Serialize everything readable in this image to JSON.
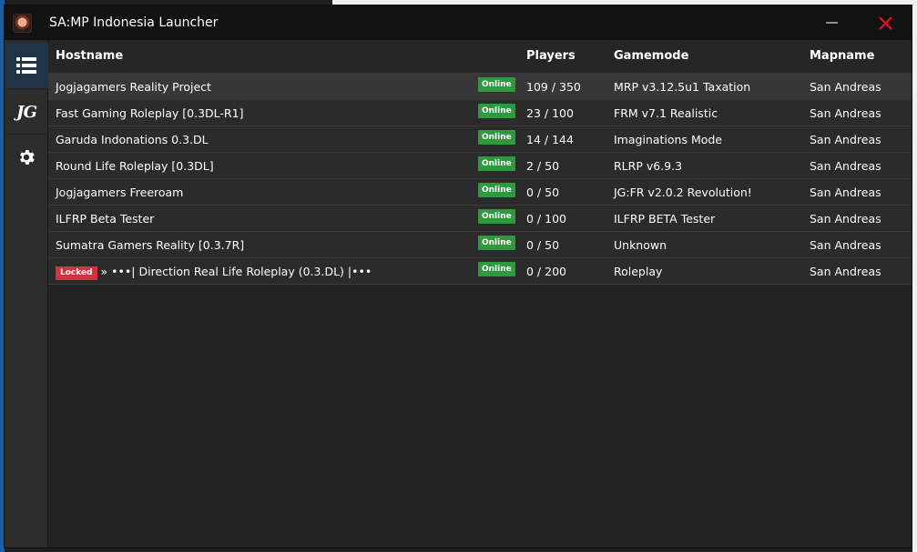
{
  "window": {
    "title": "SA:MP Indonesia Launcher"
  },
  "sidebar": {
    "items": [
      {
        "name": "server-list",
        "icon": "list-icon",
        "active": true
      },
      {
        "name": "jg",
        "label": "JG",
        "icon": "jg-logo-icon",
        "active": false
      },
      {
        "name": "settings",
        "icon": "gear-icon",
        "active": false
      }
    ]
  },
  "table": {
    "columns": {
      "hostname": "Hostname",
      "players": "Players",
      "gamemode": "Gamemode",
      "mapname": "Mapname"
    },
    "rows": [
      {
        "hostname": "Jogjagamers Reality Project",
        "status": "Online",
        "players": "109 / 350",
        "gamemode": "MRP v3.12.5u1 Taxation",
        "mapname": "San Andreas",
        "locked": false
      },
      {
        "hostname": "Fast Gaming Roleplay [0.3DL-R1]",
        "status": "Online",
        "players": "23 / 100",
        "gamemode": "FRM v7.1 Realistic",
        "mapname": "San Andreas",
        "locked": false
      },
      {
        "hostname": "Garuda Indonations 0.3.DL",
        "status": "Online",
        "players": "14 / 144",
        "gamemode": "Imaginations Mode",
        "mapname": "San Andreas",
        "locked": false
      },
      {
        "hostname": "Round Life Roleplay [0.3DL]",
        "status": "Online",
        "players": "2 / 50",
        "gamemode": "RLRP v6.9.3",
        "mapname": "San Andreas",
        "locked": false
      },
      {
        "hostname": "Jogjagamers Freeroam",
        "status": "Online",
        "players": "0 / 50",
        "gamemode": "JG:FR v2.0.2 Revolution!",
        "mapname": "San Andreas",
        "locked": false
      },
      {
        "hostname": "ILFRP Beta Tester",
        "status": "Online",
        "players": "0 / 100",
        "gamemode": "ILFRP BETA Tester",
        "mapname": "San Andreas",
        "locked": false
      },
      {
        "hostname": "Sumatra Gamers Reality [0.3.7R]",
        "status": "Online",
        "players": "0 / 50",
        "gamemode": "Unknown",
        "mapname": "San Andreas",
        "locked": false
      },
      {
        "hostname": "» •••| Direction Real Life Roleplay (0.3.DL) |•••",
        "status": "Online",
        "players": "0 / 200",
        "gamemode": "Roleplay",
        "mapname": "San Andreas",
        "locked": true,
        "locked_label": "Locked"
      }
    ]
  },
  "colors": {
    "titlebar": "#121212",
    "sidebar": "#2c2c2c",
    "sidebar_active": "#1f3447",
    "row": "#2b2b2b",
    "row_selected": "#373737",
    "online": "#2d9a3e",
    "locked": "#d6313f",
    "close": "#e81123"
  }
}
